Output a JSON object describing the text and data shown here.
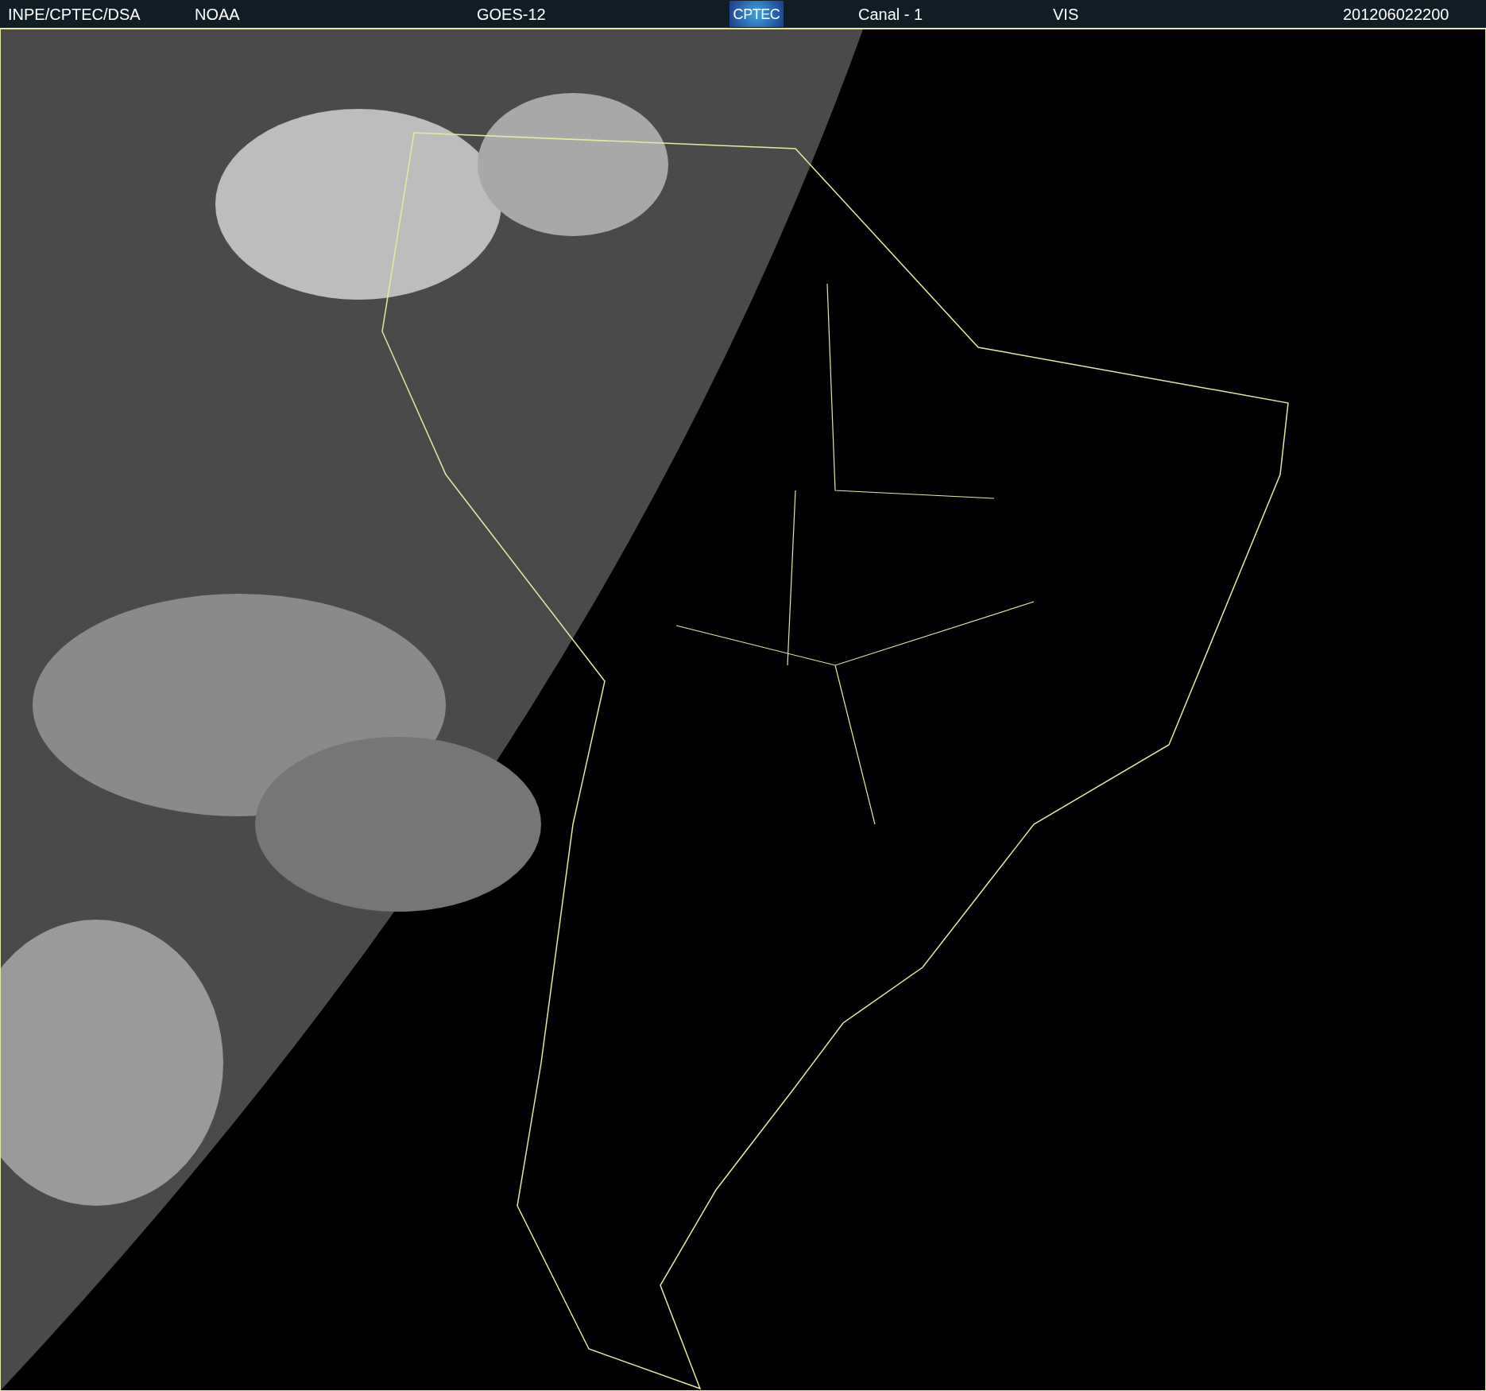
{
  "header": {
    "items": [
      {
        "kind": "text",
        "label": "INPE/CPTEC/DSA"
      },
      {
        "kind": "text",
        "label": "NOAA"
      },
      {
        "kind": "text",
        "label": "GOES-12"
      },
      {
        "kind": "logo",
        "label": "CPTEC"
      },
      {
        "kind": "text",
        "label": "Canal - 1"
      },
      {
        "kind": "text",
        "label": "VIS"
      },
      {
        "kind": "text",
        "label": "201206022200"
      }
    ]
  }
}
